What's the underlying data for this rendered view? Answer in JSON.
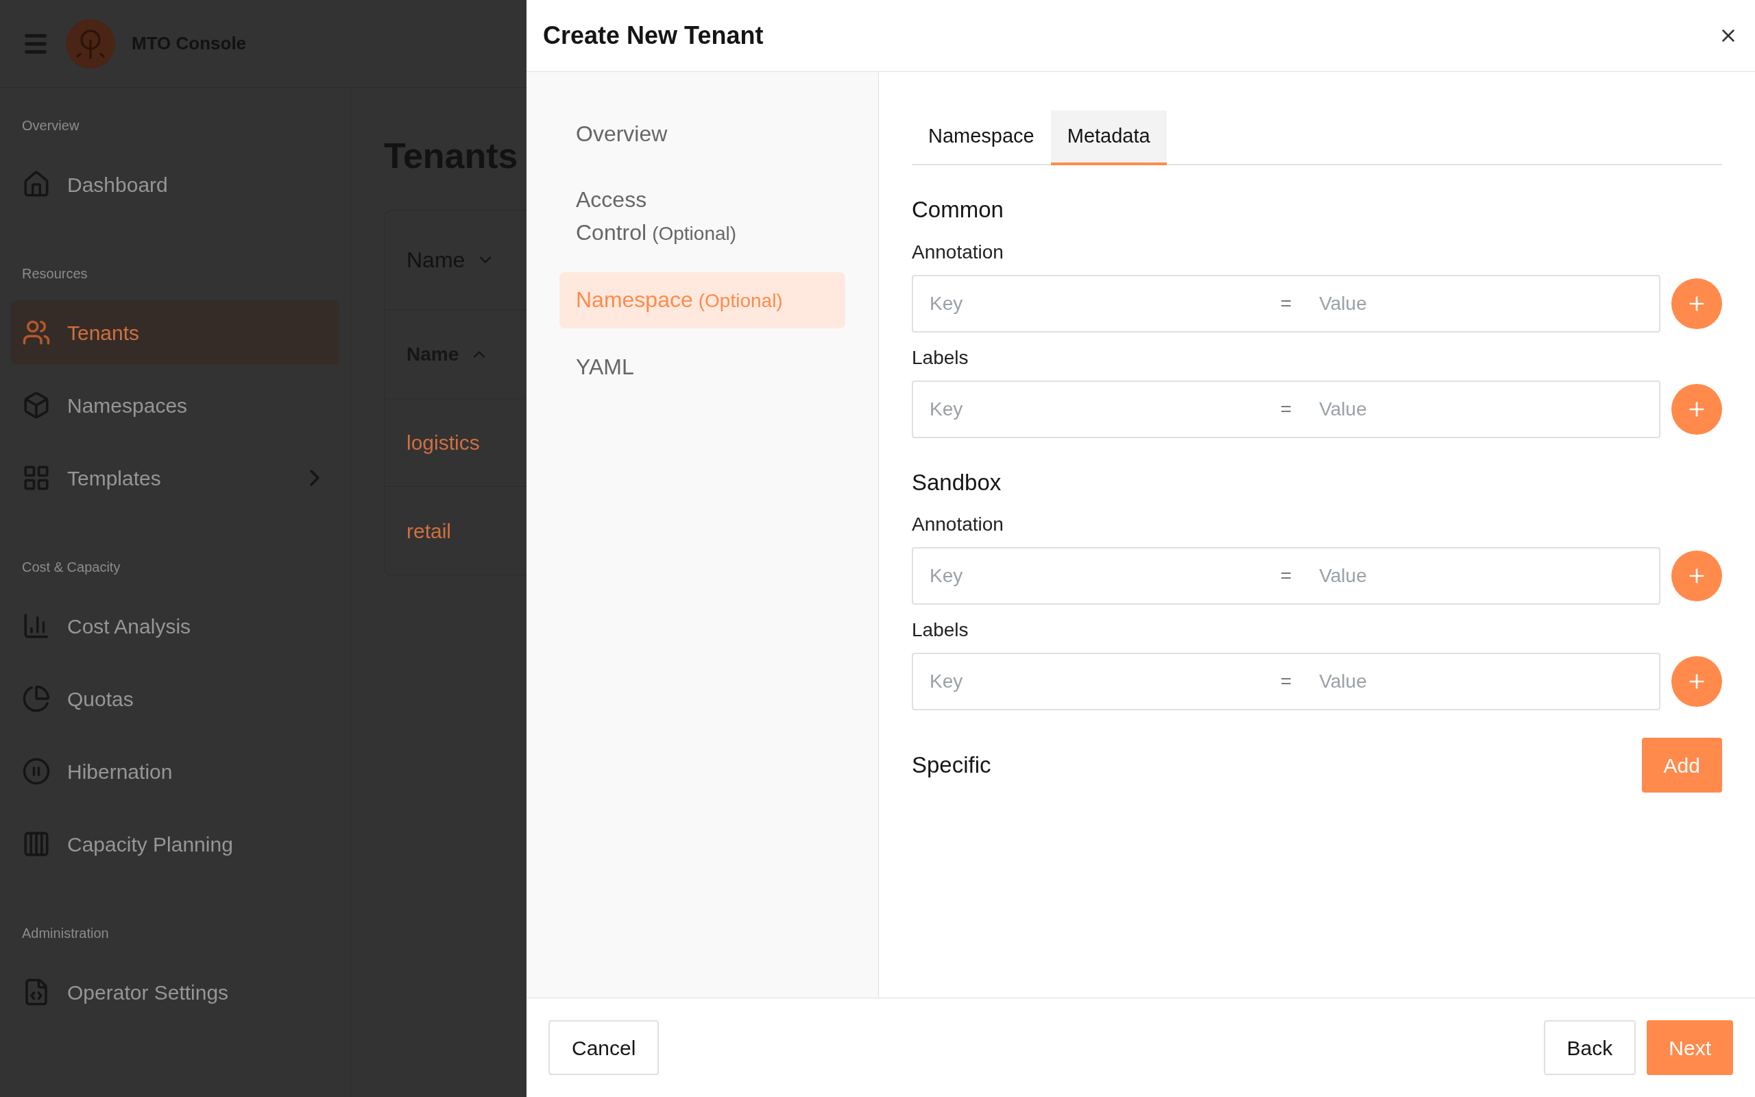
{
  "app": {
    "title": "MTO Console"
  },
  "sidebar": {
    "sections": [
      {
        "heading": "Overview",
        "items": [
          {
            "label": "Dashboard",
            "selected": false
          }
        ]
      },
      {
        "heading": "Resources",
        "items": [
          {
            "label": "Tenants",
            "selected": true
          },
          {
            "label": "Namespaces",
            "selected": false
          },
          {
            "label": "Templates",
            "selected": false,
            "has_children": true
          }
        ]
      },
      {
        "heading": "Cost & Capacity",
        "items": [
          {
            "label": "Cost Analysis",
            "selected": false
          },
          {
            "label": "Quotas",
            "selected": false
          },
          {
            "label": "Hibernation",
            "selected": false
          },
          {
            "label": "Capacity Planning",
            "selected": false
          }
        ]
      },
      {
        "heading": "Administration",
        "items": [
          {
            "label": "Operator Settings",
            "selected": false
          }
        ]
      }
    ]
  },
  "page": {
    "title": "Tenants",
    "filter": "Name",
    "column": "Name",
    "rows": [
      "logistics",
      "retail"
    ]
  },
  "dialog": {
    "title": "Create New Tenant",
    "steps": [
      {
        "label": "Overview",
        "selected": false
      },
      {
        "label": "Access Control",
        "optional": "(Optional)",
        "selected": false
      },
      {
        "label": "Namespace",
        "optional": "(Optional)",
        "selected": true
      },
      {
        "label": "YAML",
        "selected": false
      }
    ],
    "tabs": [
      {
        "label": "Namespace",
        "selected": false
      },
      {
        "label": "Metadata",
        "selected": true
      }
    ],
    "sections": [
      {
        "title": "Common",
        "groups": [
          {
            "label": "Annotation",
            "key_placeholder": "Key",
            "separator": "=",
            "value_placeholder": "Value"
          },
          {
            "label": "Labels",
            "key_placeholder": "Key",
            "separator": "=",
            "value_placeholder": "Value"
          }
        ]
      },
      {
        "title": "Sandbox",
        "groups": [
          {
            "label": "Annotation",
            "key_placeholder": "Key",
            "separator": "=",
            "value_placeholder": "Value"
          },
          {
            "label": "Labels",
            "key_placeholder": "Key",
            "separator": "=",
            "value_placeholder": "Value"
          }
        ]
      }
    ],
    "specific": {
      "title": "Specific",
      "button": "Add"
    },
    "footer": {
      "cancel": "Cancel",
      "back": "Back",
      "next": "Next"
    }
  }
}
